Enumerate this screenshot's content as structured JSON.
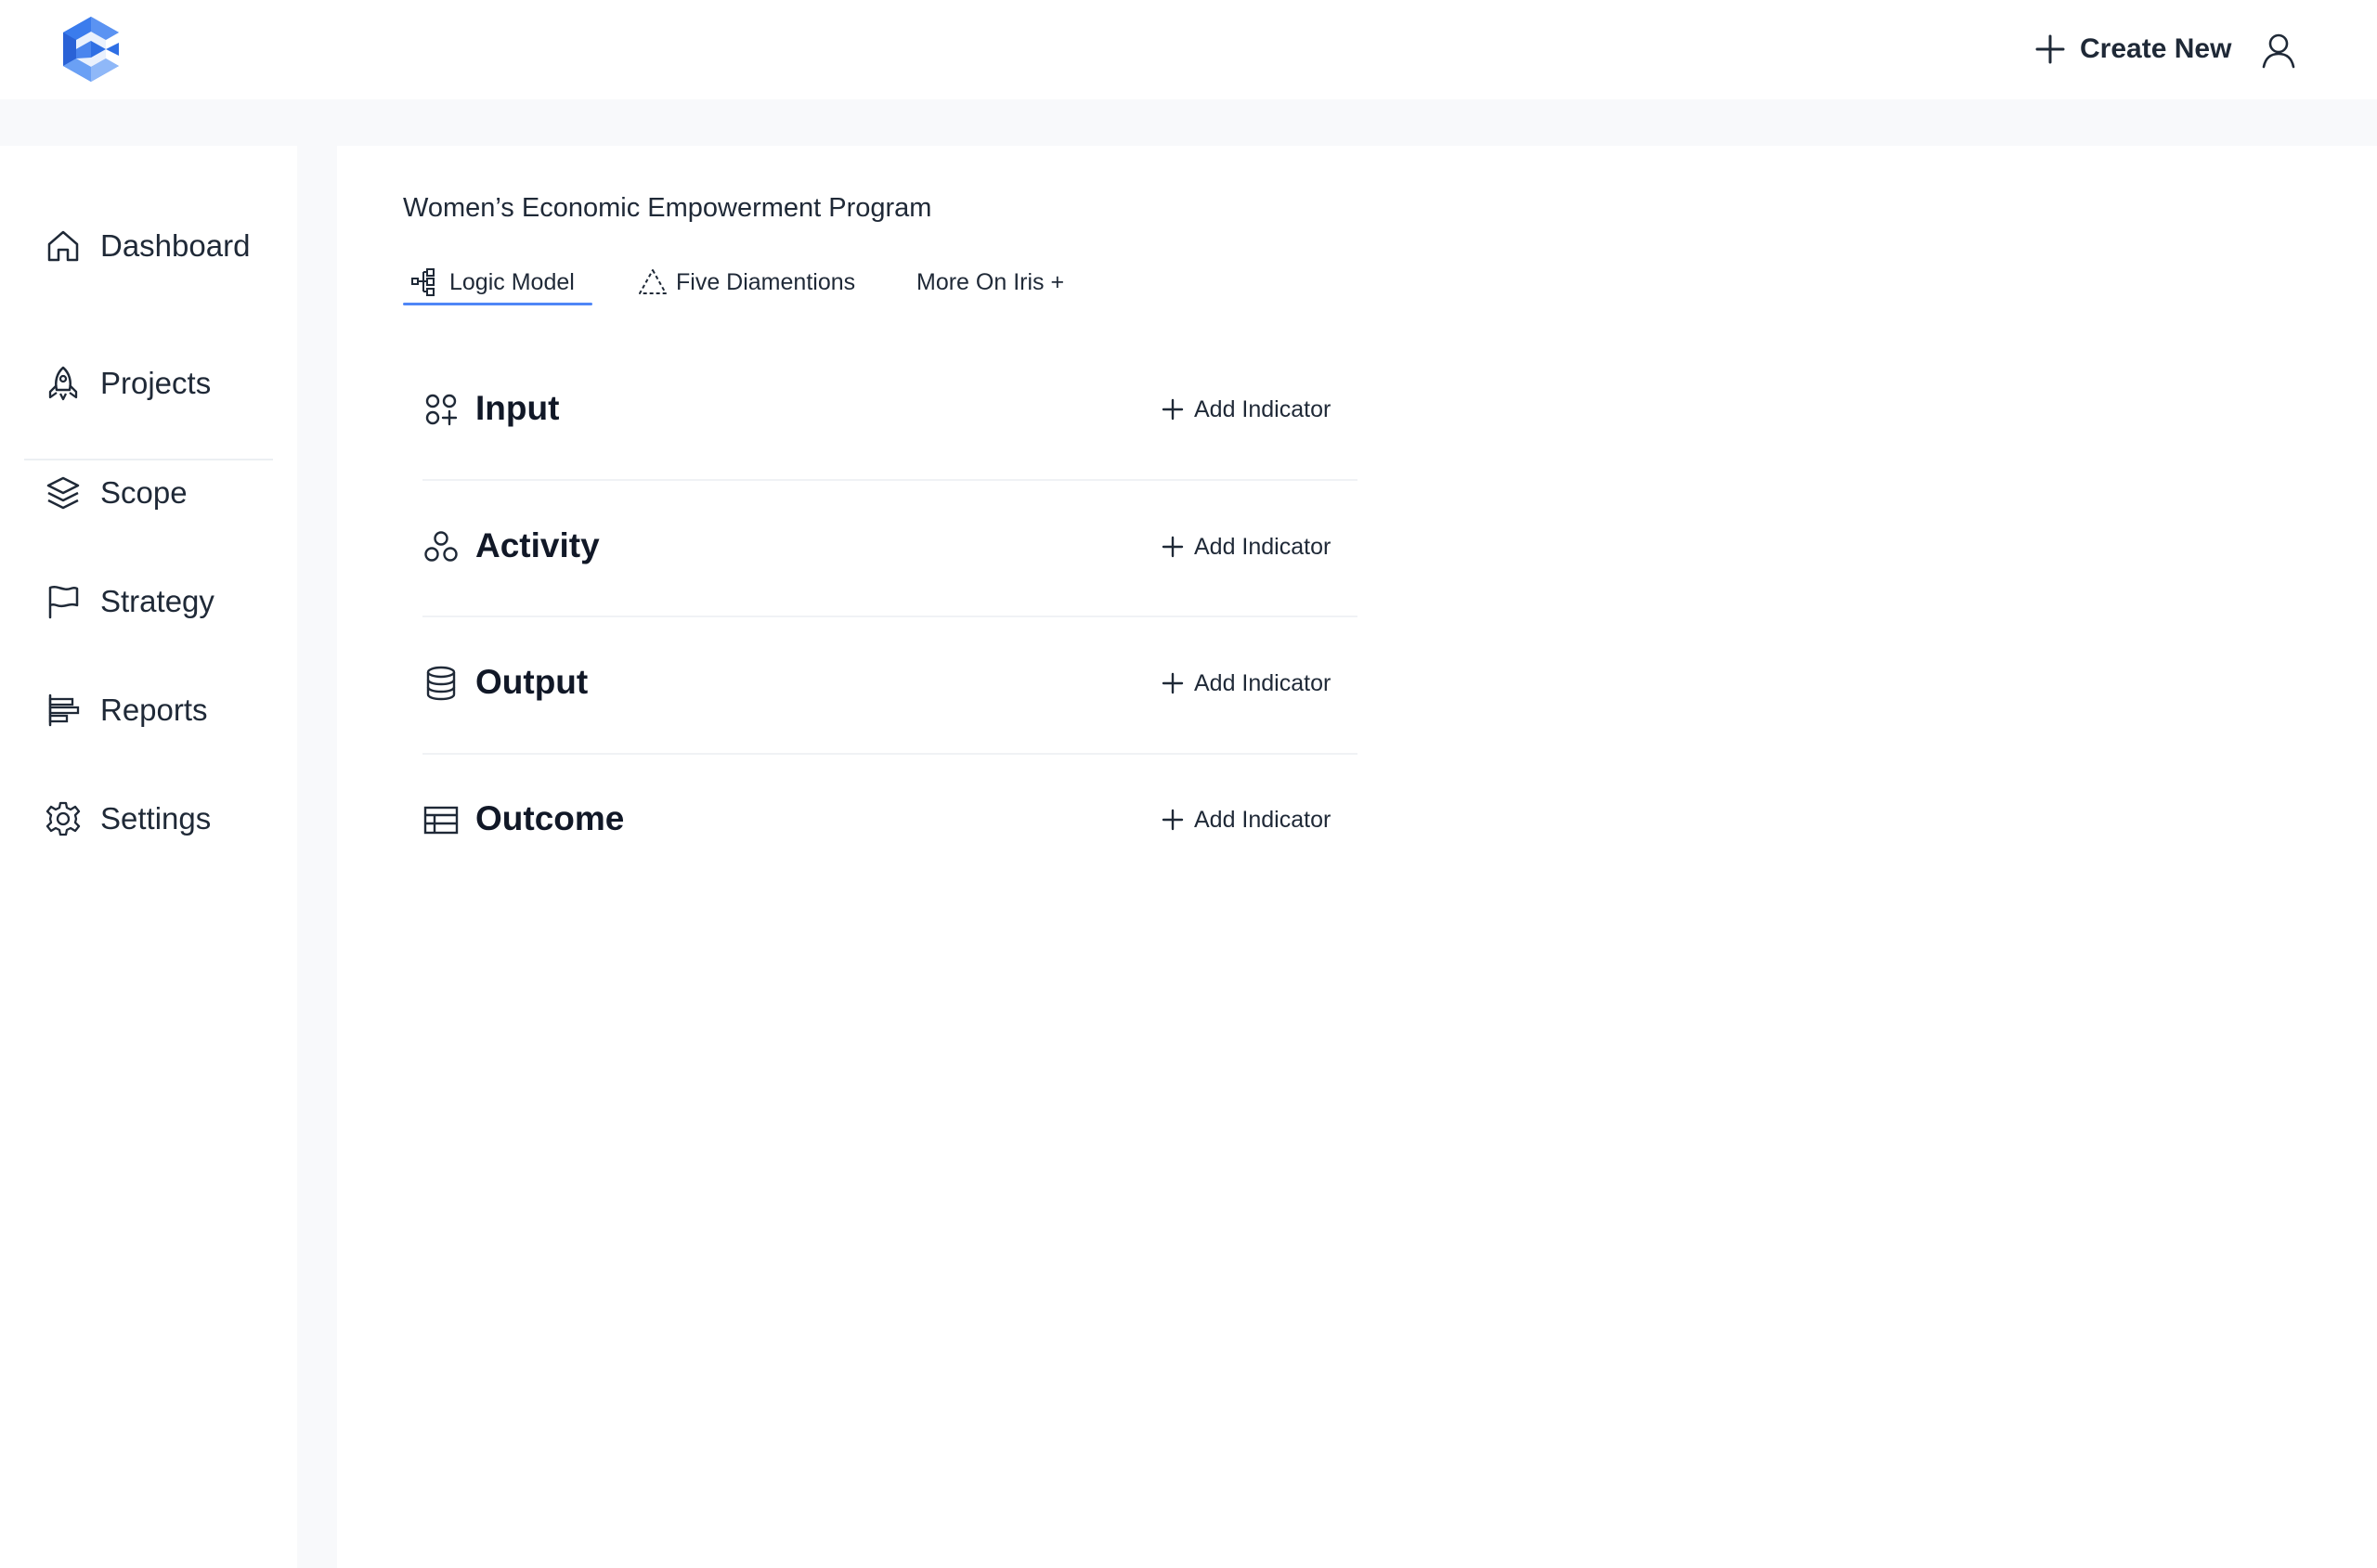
{
  "header": {
    "create_new_label": "Create New",
    "logo_icon": "cube-c-logo",
    "user_icon": "user-icon",
    "brand_color": "#3b82f6"
  },
  "sidebar": {
    "items": [
      {
        "label": "Dashboard",
        "icon": "home-icon"
      },
      {
        "label": "Projects",
        "icon": "rocket-icon"
      },
      {
        "label": "Scope",
        "icon": "layers-icon"
      },
      {
        "label": "Strategy",
        "icon": "flag-icon"
      },
      {
        "label": "Reports",
        "icon": "bar-chart-icon"
      },
      {
        "label": "Settings",
        "icon": "gear-icon"
      }
    ]
  },
  "main": {
    "title": "Women’s Economic Empowerment Program",
    "tabs": [
      {
        "label": "Logic Model",
        "icon": "flow-icon",
        "active": true
      },
      {
        "label": "Five Diamentions",
        "icon": "triangle-dashed-icon",
        "active": false
      },
      {
        "label": "More On Iris +",
        "active": false
      }
    ],
    "sections": [
      {
        "title": "Input",
        "icon": "grid-plus-icon",
        "action": "Add Indicator"
      },
      {
        "title": "Activity",
        "icon": "circles-icon",
        "action": "Add Indicator"
      },
      {
        "title": "Output",
        "icon": "database-icon",
        "action": "Add Indicator"
      },
      {
        "title": "Outcome",
        "icon": "table-icon",
        "action": "Add Indicator"
      }
    ]
  },
  "colors": {
    "accent": "#4f86f7",
    "text": "#1f2937",
    "page_background": "#f8f9fb"
  }
}
